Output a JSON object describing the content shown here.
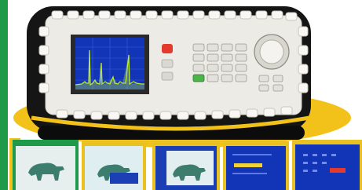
{
  "colors": {
    "accent_green": "#1f9a4a",
    "case_yellow": "#f2c21a",
    "case_black": "#151515",
    "panel_white": "#ecebe6",
    "screen_blue": "#1235b8",
    "spectrum_green": "#b8e63a"
  },
  "thumbnails": [
    {
      "id": "thumb-1",
      "content": "polar-bear",
      "frame": "green"
    },
    {
      "id": "thumb-2",
      "content": "polar-bear-with-overlay",
      "frame": "yellow"
    },
    {
      "id": "thumb-3",
      "content": "polar-bear-blue-menu",
      "frame": "yellow"
    },
    {
      "id": "thumb-4",
      "content": "menu-screen",
      "frame": "yellow"
    },
    {
      "id": "thumb-5",
      "content": "menu-screen",
      "frame": "yellow"
    }
  ]
}
